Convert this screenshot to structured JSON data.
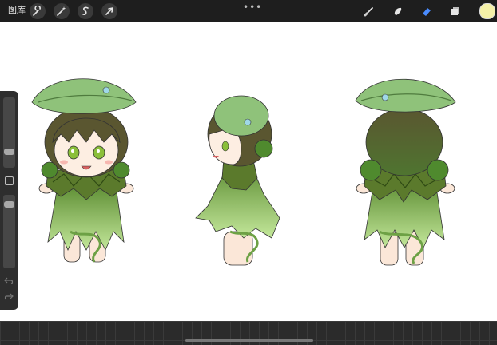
{
  "toolbar": {
    "gallery_label": "图库",
    "left_tools": [
      "wrench-icon",
      "magic-wand-icon",
      "selection-s-icon",
      "move-arrow-icon"
    ],
    "more_label": "•••",
    "right_tools": [
      "brush-icon",
      "smudge-icon",
      "eraser-icon",
      "layers-icon"
    ],
    "active_tool": "eraser-icon",
    "current_color": "#f5f1a8",
    "accent": "#4a8cff"
  },
  "sidebar": {
    "brush_size": 0.68,
    "opacity": 0.16,
    "icons": [
      "modify-square-icon",
      "undo-icon",
      "redo-icon"
    ]
  }
}
